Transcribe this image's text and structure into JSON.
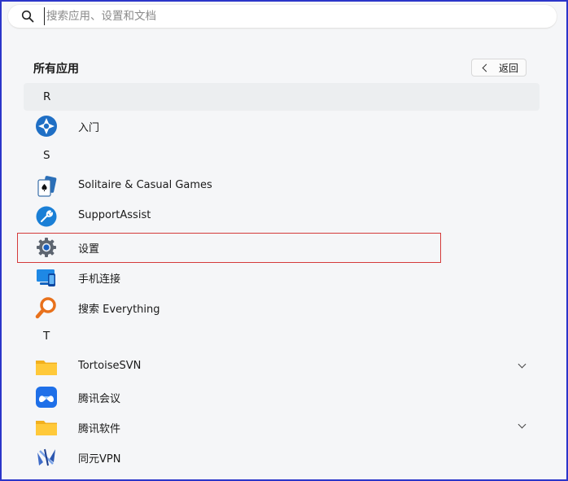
{
  "search": {
    "placeholder": "搜索应用、设置和文档"
  },
  "all_apps": {
    "title": "所有应用",
    "back_label": "返回"
  },
  "sections": [
    {
      "letter": "R"
    },
    {
      "letter": "S"
    },
    {
      "letter": "T"
    }
  ],
  "apps": [
    {
      "label": "入门",
      "icon": "get-started-icon",
      "expandable": false
    },
    {
      "label": "Solitaire & Casual Games",
      "icon": "solitaire-icon",
      "expandable": false
    },
    {
      "label": "SupportAssist",
      "icon": "support-assist-icon",
      "expandable": false
    },
    {
      "label": "设置",
      "icon": "settings-gear-icon",
      "expandable": false,
      "highlighted": true
    },
    {
      "label": "手机连接",
      "icon": "phone-link-icon",
      "expandable": false
    },
    {
      "label": "搜索 Everything",
      "icon": "magnifier-icon",
      "expandable": false
    },
    {
      "label": "TortoiseSVN",
      "icon": "folder-icon",
      "expandable": true
    },
    {
      "label": "腾讯会议",
      "icon": "tencent-meeting-icon",
      "expandable": false
    },
    {
      "label": "腾讯软件",
      "icon": "folder-icon",
      "expandable": true
    },
    {
      "label": "同元VPN",
      "icon": "vpn-icon",
      "expandable": false
    }
  ],
  "colors": {
    "frame_border": "#2b35c9",
    "highlight_box": "#d43a3a",
    "accent_blue": "#1a7fd6"
  }
}
